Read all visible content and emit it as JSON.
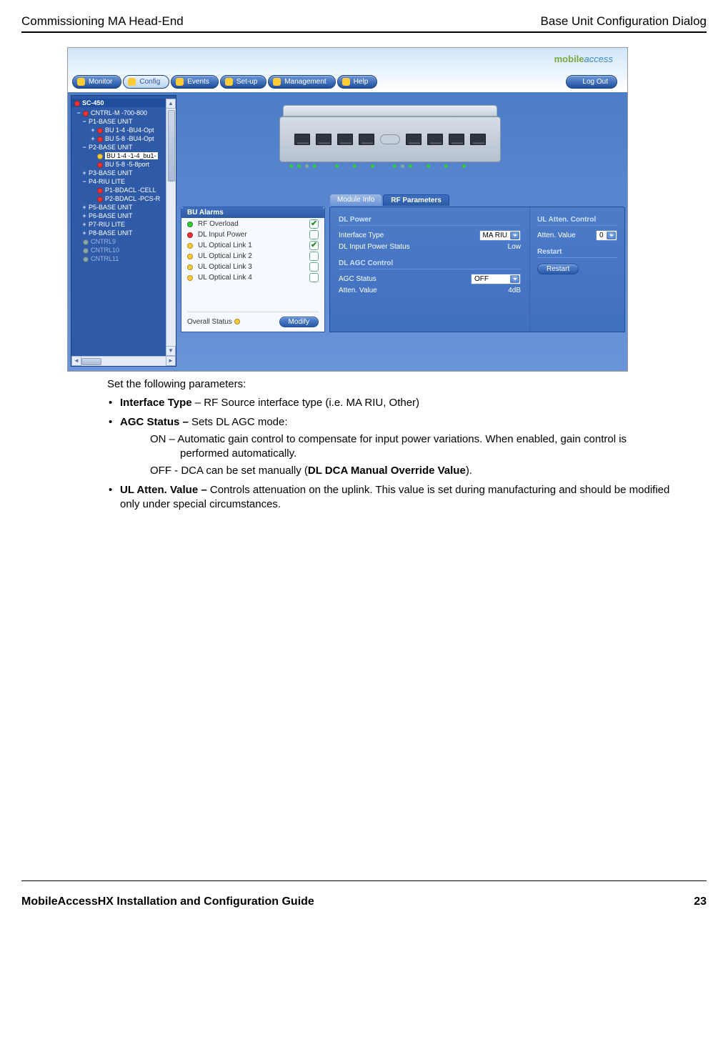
{
  "page_header": {
    "left": "Commissioning MA Head-End",
    "right": "Base Unit Configuration Dialog"
  },
  "screenshot": {
    "logo": {
      "brand_a": "mobile",
      "brand_b": "access"
    },
    "nav": {
      "items": [
        "Monitor",
        "Config",
        "Events",
        "Set-up",
        "Management",
        "Help"
      ],
      "active_index": 1,
      "logout": "Log Out"
    },
    "tree": {
      "root": "SC-450",
      "nodes": [
        {
          "exp": "−",
          "dot": "red",
          "label": "CNTRL-M -700-800",
          "indent": 0
        },
        {
          "exp": "−",
          "dot": "",
          "label": "P1-BASE UNIT",
          "indent": 1
        },
        {
          "exp": "+",
          "dot": "red",
          "label": "BU 1-4 -BU4-Opt",
          "indent": 2
        },
        {
          "exp": "+",
          "dot": "red",
          "label": "BU 5-8 -BU4-Opt",
          "indent": 2
        },
        {
          "exp": "−",
          "dot": "",
          "label": "P2-BASE UNIT",
          "indent": 1
        },
        {
          "exp": "",
          "dot": "yellow",
          "label": "BU 1-4 -1-4_bu1-",
          "indent": 2,
          "selected": true
        },
        {
          "exp": "",
          "dot": "red",
          "label": "BU 5-8 -5-8port",
          "indent": 2
        },
        {
          "exp": "+",
          "dot": "",
          "label": "P3-BASE UNIT",
          "indent": 1
        },
        {
          "exp": "−",
          "dot": "",
          "label": "P4-RIU LITE",
          "indent": 1
        },
        {
          "exp": "",
          "dot": "red",
          "label": "P1-BDACL -CELL",
          "indent": 2
        },
        {
          "exp": "",
          "dot": "red",
          "label": "P2-BDACL -PCS-R",
          "indent": 2
        },
        {
          "exp": "+",
          "dot": "",
          "label": "P5-BASE UNIT",
          "indent": 1
        },
        {
          "exp": "+",
          "dot": "",
          "label": "P6-BASE UNIT",
          "indent": 1
        },
        {
          "exp": "+",
          "dot": "",
          "label": "P7-RIU LITE",
          "indent": 1
        },
        {
          "exp": "+",
          "dot": "",
          "label": "P8-BASE UNIT",
          "indent": 1
        },
        {
          "exp": "",
          "dot": "grey",
          "label": "CNTRL9",
          "indent": 0,
          "dim": true
        },
        {
          "exp": "",
          "dot": "grey",
          "label": "CNTRL10",
          "indent": 0,
          "dim": true
        },
        {
          "exp": "",
          "dot": "grey",
          "label": "CNTRL11",
          "indent": 0,
          "dim": true
        }
      ]
    },
    "bu_alarms": {
      "title": "BU Alarms",
      "items": [
        {
          "dot": "green",
          "label": "RF Overload",
          "checked": true
        },
        {
          "dot": "red",
          "label": "DL Input Power",
          "checked": false
        },
        {
          "dot": "yellow",
          "label": "UL Optical Link 1",
          "checked": true
        },
        {
          "dot": "yellow",
          "label": "UL Optical Link 2",
          "checked": false
        },
        {
          "dot": "yellow",
          "label": "UL Optical Link 3",
          "checked": false
        },
        {
          "dot": "yellow",
          "label": "UL Optical Link 4",
          "checked": false
        }
      ],
      "overall_label": "Overall Status",
      "overall_dot": "yellow",
      "modify": "Modify"
    },
    "rf": {
      "tabs": {
        "inactive": "Module Info",
        "active": "RF Parameters"
      },
      "dl_power": {
        "title": "DL Power",
        "interface_type_label": "Interface Type",
        "interface_type_value": "MA RIU",
        "dl_input_label": "DL Input Power Status",
        "dl_input_value": "Low"
      },
      "dl_agc": {
        "title": "DL AGC Control",
        "agc_status_label": "AGC Status",
        "agc_status_value": "OFF",
        "atten_label": "Atten. Value",
        "atten_value": "4dB"
      },
      "ul": {
        "title": "UL Atten. Control",
        "atten_label": "Atten. Value",
        "atten_value": "0",
        "restart_label": "Restart",
        "restart_btn": "Restart"
      }
    }
  },
  "body": {
    "intro": "Set the following parameters:",
    "b1_bold": "Interface Type",
    "b1_rest": " – RF Source interface type (i.e. MA RIU, Other)",
    "b2_bold": "AGC Status – ",
    "b2_rest": "Sets DL AGC mode:",
    "b2_on": "ON – Automatic gain control to compensate for input power variations. When enabled, gain control is performed automatically.",
    "b2_off_a": "OFF - DCA can be set manually (",
    "b2_off_b": "DL DCA Manual Override Value",
    "b2_off_c": ").",
    "b3_bold": "UL Atten. Value – ",
    "b3_rest": "Controls attenuation on the uplink. This value is set during manufacturing and should be modified only under special circumstances."
  },
  "footer": {
    "left": "MobileAccessHX Installation and Configuration Guide",
    "right": "23"
  }
}
